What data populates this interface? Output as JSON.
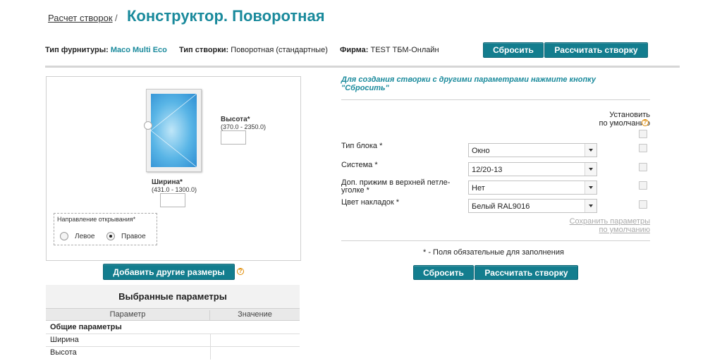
{
  "breadcrumb": {
    "link_label": "Расчет створок",
    "separator": "/"
  },
  "title": "Конструктор. Поворотная",
  "info": {
    "hardware_label": "Тип фурнитуры:",
    "hardware_value": "Maco Multi Eco",
    "sash_type_label": "Тип створки:",
    "sash_type_value": "Поворотная (стандартные)",
    "company_label": "Фирма:",
    "company_value": "TEST ТБМ-Онлайн"
  },
  "buttons": {
    "reset": "Сбросить",
    "calculate": "Рассчитать створку",
    "add_sizes": "Добавить другие размеры"
  },
  "drawing": {
    "height_label": "Высота*",
    "height_range": "(370.0 - 2350.0)",
    "width_label": "Ширина*",
    "width_range": "(431.0 - 1300.0)",
    "direction_title": "Направление открывания*",
    "direction_options": [
      "Левое",
      "Правое"
    ],
    "direction_selected": "Правое"
  },
  "selected_params": {
    "title": "Выбранные параметры",
    "columns": [
      "Параметр",
      "Значение"
    ],
    "group": "Общие параметры",
    "rows": [
      "Ширина",
      "Высота"
    ]
  },
  "form": {
    "hint": "Для создания створки с другими параметрами нажмите кнопку \"Сбросить\"",
    "default_header_line1": "Установить",
    "default_header_line2": "по умолчанию",
    "fields": [
      {
        "label": "Тип блока *",
        "value": "Окно"
      },
      {
        "label": "Система *",
        "value": "12/20-13"
      },
      {
        "label": "Доп. прижим в верхней петле-",
        "label2": "уголке *",
        "value": "Нет"
      },
      {
        "label": "Цвет накладок *",
        "value": "Белый RAL9016"
      }
    ],
    "save_defaults_line1": "Сохранить параметры",
    "save_defaults_line2": "по умолчанию",
    "required_note": "* - Поля обязательные для заполнения"
  },
  "icons": {
    "help": "question-icon",
    "help_glyph": "?"
  },
  "colors": {
    "accent": "#1a8a9c",
    "button": "#137d8e",
    "help": "#e08a00"
  }
}
